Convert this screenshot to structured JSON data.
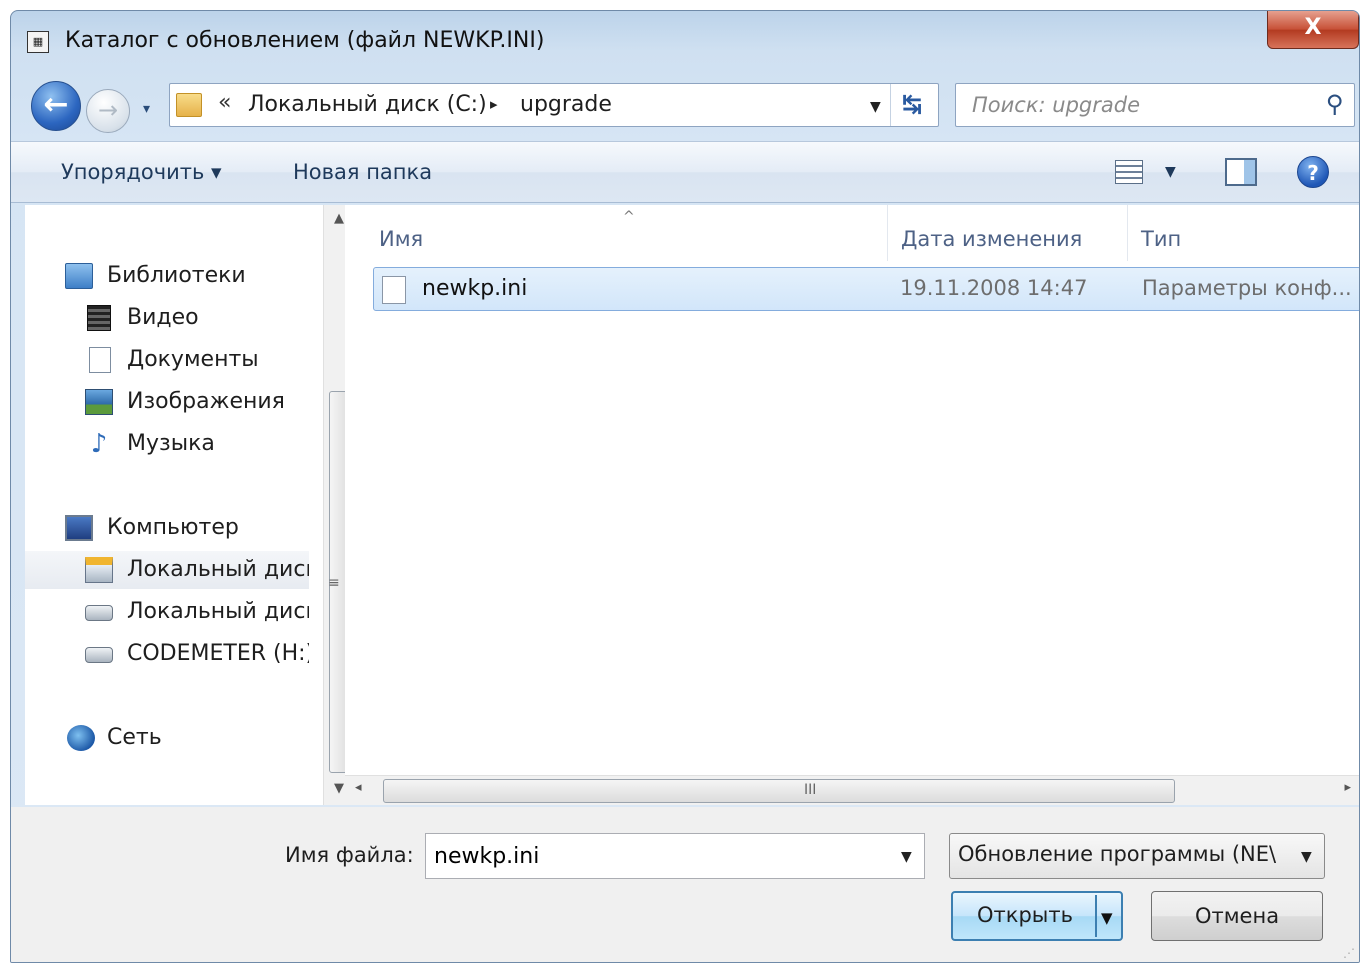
{
  "window": {
    "title": "Каталог с обновлением (файл NEWKP.INI)",
    "close_glyph": "X"
  },
  "nav": {
    "back_glyph": "←",
    "forward_glyph": "→",
    "history_glyph": "▾",
    "address": {
      "overflow_glyph": "«",
      "segments": [
        "Локальный диск (C:)",
        "upgrade"
      ],
      "separator_glyph": "▸",
      "dropdown_glyph": "▼",
      "refresh_glyph": "↹"
    },
    "search": {
      "placeholder": "Поиск: upgrade",
      "icon": "search-icon"
    }
  },
  "toolbar": {
    "organize_label": "Упорядочить ▾",
    "new_folder_label": "Новая папка",
    "views_dropdown_glyph": "▼",
    "help_glyph": "?"
  },
  "sidebar": {
    "items": [
      {
        "label": "Библиотеки",
        "icon": "libraries-icon"
      },
      {
        "label": "Видео",
        "icon": "video-icon"
      },
      {
        "label": "Документы",
        "icon": "documents-icon"
      },
      {
        "label": "Изображения",
        "icon": "pictures-icon"
      },
      {
        "label": "Музыка",
        "icon": "music-icon"
      },
      {
        "label": "Компьютер",
        "icon": "computer-icon"
      },
      {
        "label": "Локальный диск",
        "icon": "system-drive-icon",
        "selected": true
      },
      {
        "label": "Локальный диск",
        "icon": "drive-icon"
      },
      {
        "label": "CODEMETER (H:)",
        "icon": "drive-icon"
      },
      {
        "label": "Сеть",
        "icon": "network-icon"
      }
    ],
    "music_glyph": "♪",
    "scroll_up_glyph": "▲",
    "scroll_down_glyph": "▼",
    "scroll_grip_glyph": "≡"
  },
  "file_list": {
    "columns": [
      "Имя",
      "Дата изменения",
      "Тип"
    ],
    "sort_glyph": "^",
    "rows": [
      {
        "name": "newkp.ini",
        "date": "19.11.2008 14:47",
        "type": "Параметры конф...",
        "selected": true
      }
    ],
    "hscroll": {
      "left_glyph": "◂",
      "right_glyph": "▸",
      "grip_glyph": "III"
    }
  },
  "footer": {
    "filename_label": "Имя файла:",
    "filename_value": "newkp.ini",
    "filename_drop_glyph": "▼",
    "filetype_value": "Обновление программы (NE\\",
    "filetype_drop_glyph": "▼",
    "open_label": "Открыть",
    "open_drop_glyph": "▼",
    "cancel_label": "Отмена",
    "resize_glyph": "⋰"
  },
  "colors": {
    "accent": "#3c7fb1",
    "selection_fill": "#d2e6fa",
    "close_red": "#c75036"
  }
}
